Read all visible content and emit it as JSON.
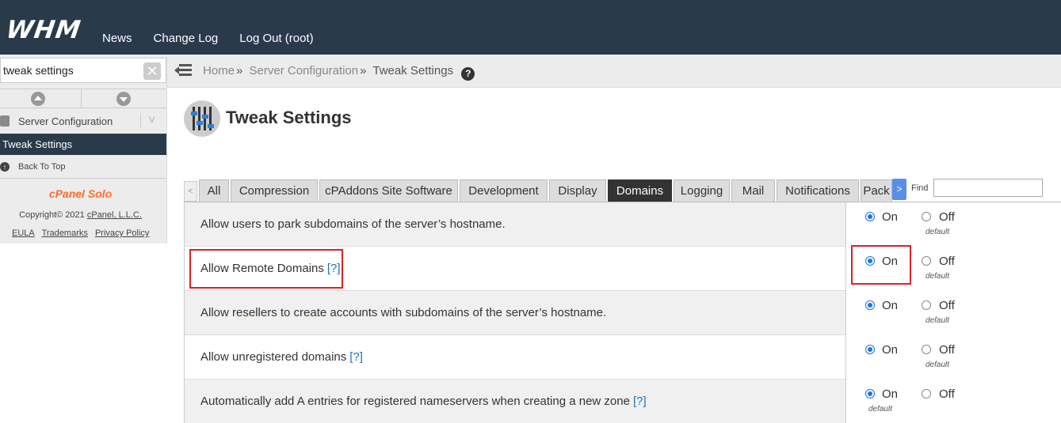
{
  "app": {
    "logo": "WHM",
    "nav": [
      "News",
      "Change Log",
      "Log Out (root)"
    ]
  },
  "sidebar": {
    "search_value": "tweak settings",
    "section": "Server Configuration",
    "active_item": "Tweak Settings",
    "back_to_top": "Back To Top",
    "brand": "cPanel Solo",
    "copyright_prefix": "Copyright© 2021 ",
    "copyright_link": "cPanel, L.L.C.",
    "legal_links": [
      "EULA",
      "Trademarks",
      "Privacy Policy"
    ]
  },
  "breadcrumb": {
    "items": [
      "Home",
      "Server Configuration",
      "Tweak Settings"
    ],
    "separator": "»"
  },
  "page": {
    "title": "Tweak Settings"
  },
  "tabs": {
    "scroll_left": "<",
    "scroll_right": ">",
    "items": [
      "All",
      "Compression",
      "cPAddons Site Software",
      "Development",
      "Display",
      "Domains",
      "Logging",
      "Mail",
      "Notifications",
      "Pack"
    ],
    "active": "Domains",
    "find_label": "Find",
    "find_value": ""
  },
  "settings": [
    {
      "label": "Allow users to park subdomains of the server’s hostname.",
      "help": "",
      "value": "On",
      "on_label": "On",
      "off_label": "Off",
      "default_note": "default",
      "default_under": "Off"
    },
    {
      "label": "Allow Remote Domains",
      "help": "[?]",
      "value": "On",
      "on_label": "On",
      "off_label": "Off",
      "default_note": "default",
      "default_under": "Off"
    },
    {
      "label": "Allow resellers to create accounts with subdomains of the server’s hostname.",
      "help": "",
      "value": "On",
      "on_label": "On",
      "off_label": "Off",
      "default_note": "default",
      "default_under": "Off"
    },
    {
      "label": "Allow unregistered domains",
      "help": "[?]",
      "value": "On",
      "on_label": "On",
      "off_label": "Off",
      "default_note": "default",
      "default_under": "Off"
    },
    {
      "label": "Automatically add A entries for registered nameservers when creating a new zone",
      "help": "[?]",
      "value": "On",
      "on_label": "On",
      "off_label": "Off",
      "default_note": "default",
      "default_under": "On"
    }
  ],
  "colors": {
    "header_bg": "#293a4a",
    "highlight": "#d9222a",
    "radio_accent": "#1a73e8",
    "link": "#1e72b8"
  }
}
